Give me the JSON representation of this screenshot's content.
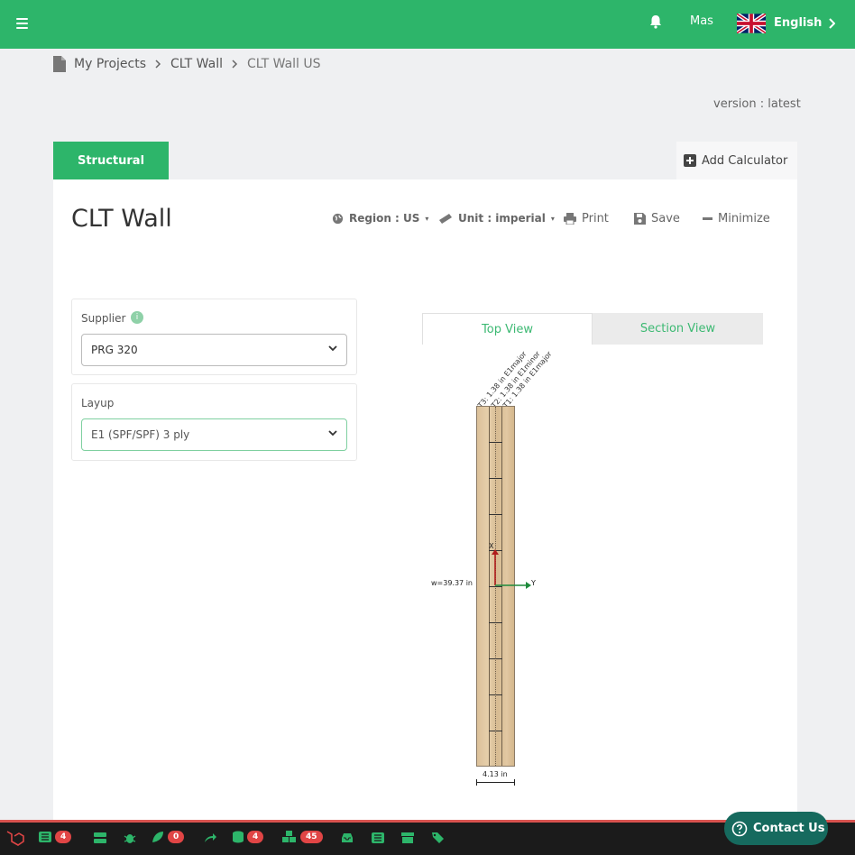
{
  "header": {
    "user": "Mas",
    "language": "English"
  },
  "breadcrumb": [
    "My Projects",
    "CLT Wall",
    "CLT Wall US"
  ],
  "version": "version : latest",
  "tabs": {
    "structural": "Structural",
    "add_calculator": "Add Calculator"
  },
  "calculator": {
    "title": "CLT Wall",
    "region": "Region : US",
    "unit": "Unit : imperial",
    "print": "Print",
    "save": "Save",
    "minimize": "Minimize"
  },
  "form": {
    "supplier_label": "Supplier",
    "supplier_info": "i",
    "supplier_value": "PRG 320",
    "layup_label": "Layup",
    "layup_value": "E1 (SPF/SPF) 3 ply"
  },
  "view_tabs": {
    "top": "Top View",
    "section": "Section View"
  },
  "diagram": {
    "plies": [
      "T3: 1.38 in E1major",
      "T2: 1.38 in E1minor",
      "T1: 1.38 in E1major"
    ],
    "width_label": "w=39.37 in",
    "thickness_label": "4.13 in",
    "axis_x": "X",
    "axis_y": "Y"
  },
  "devbar": {
    "badges": [
      "4",
      "0",
      "4",
      "45"
    ]
  },
  "contact": "Contact Us",
  "colors": {
    "brand": "#2db56a",
    "badge": "#e04545",
    "contact": "#166a5e"
  }
}
